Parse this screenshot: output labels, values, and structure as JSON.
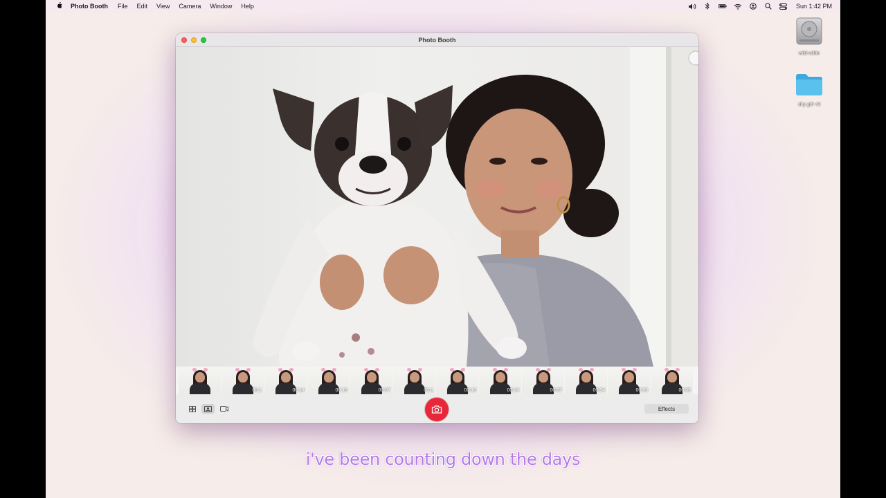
{
  "menubar": {
    "apple_icon": "apple-logo-icon",
    "app_name": "Photo Booth",
    "menus": [
      "File",
      "Edit",
      "View",
      "Camera",
      "Window",
      "Help"
    ],
    "status_icons": [
      "volume-icon",
      "bluetooth-icon",
      "battery-icon",
      "wifi-icon",
      "user-icon",
      "search-icon",
      "control-center-icon"
    ],
    "clock": "Sun 1:42 PM"
  },
  "desktop": {
    "icons": [
      {
        "label": "wild-wilde",
        "icon": "hard-drive-icon"
      },
      {
        "label": "shy girl <3",
        "icon": "folder-icon"
      }
    ]
  },
  "window": {
    "title": "Photo Booth",
    "filmstrip": [
      {
        "duration": ""
      },
      {
        "duration": "00:1"
      },
      {
        "duration": "00:14"
      },
      {
        "duration": "00:10"
      },
      {
        "duration": "00:07"
      },
      {
        "duration": "00:1"
      },
      {
        "duration": "00:10"
      },
      {
        "duration": "00:24"
      },
      {
        "duration": "00:07"
      },
      {
        "duration": "00:54"
      },
      {
        "duration": "00:53"
      },
      {
        "duration": "00:55"
      }
    ],
    "toolbar": {
      "view_buttons": [
        "grid-view-icon",
        "photo-view-icon",
        "video-view-icon"
      ],
      "active_view": "photo-view-icon",
      "shutter_icon": "camera-icon",
      "effects_label": "Effects"
    }
  },
  "caption": "i've been counting down the days",
  "colors": {
    "shutter": "#e8283a",
    "caption": "#b57ae8",
    "folder": "#5ac0ee"
  }
}
